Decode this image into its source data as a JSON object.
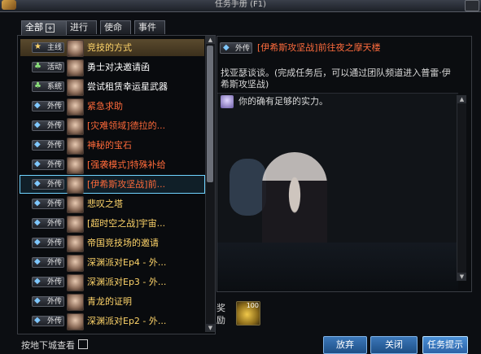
{
  "window": {
    "title": "任务手册 (F1)"
  },
  "tabs": [
    "全部",
    "进行",
    "使命",
    "事件"
  ],
  "quests": [
    {
      "badge": "主线",
      "name": "竞技的方式",
      "color": "#ffd56a",
      "icon": "star-icon"
    },
    {
      "badge": "活动",
      "name": "勇士对决邀请函",
      "color": "#ffffff",
      "icon": "leaf-icon"
    },
    {
      "badge": "系统",
      "name": "尝试租赁幸运星武器",
      "color": "#ffffff",
      "icon": "leaf-icon"
    },
    {
      "badge": "外传",
      "name": "紧急求助",
      "color": "#ff6a3a",
      "icon": "diamond-icon"
    },
    {
      "badge": "外传",
      "name": "[灾难领域]德拉的...",
      "color": "#ff6a3a",
      "icon": "diamond-icon"
    },
    {
      "badge": "外传",
      "name": "神秘的宝石",
      "color": "#ff6a3a",
      "icon": "diamond-icon"
    },
    {
      "badge": "外传",
      "name": "[强袭模式]特殊补给",
      "color": "#ff6a3a",
      "icon": "diamond-icon"
    },
    {
      "badge": "外传",
      "name": "[伊希斯攻坚战]前...",
      "color": "#ff6a3a",
      "icon": "diamond-icon",
      "selected": true
    },
    {
      "badge": "外传",
      "name": "悲叹之塔",
      "color": "#ffd56a",
      "icon": "diamond-icon"
    },
    {
      "badge": "外传",
      "name": "[超时空之战]宇宙...",
      "color": "#ffd56a",
      "icon": "diamond-icon"
    },
    {
      "badge": "外传",
      "name": "帝国竞技场的邀请",
      "color": "#ffd56a",
      "icon": "diamond-icon"
    },
    {
      "badge": "外传",
      "name": "深渊派对Ep4 - 外...",
      "color": "#ffd56a",
      "icon": "diamond-icon"
    },
    {
      "badge": "外传",
      "name": "深渊派对Ep3 - 外...",
      "color": "#ffd56a",
      "icon": "diamond-icon"
    },
    {
      "badge": "外传",
      "name": "青龙的证明",
      "color": "#ffd56a",
      "icon": "diamond-icon"
    },
    {
      "badge": "外传",
      "name": "深渊派对Ep2 - 外...",
      "color": "#ffd56a",
      "icon": "diamond-icon"
    }
  ],
  "detail": {
    "badge": "外传",
    "title": "[伊希斯攻坚战]前往夜之摩天楼",
    "description": "找亚瑟谈谈。(完成任务后，可以通过团队频道进入普雷·伊希斯攻坚战)",
    "npc_line": "你的确有足够的实力。"
  },
  "reward": {
    "label": "奖励",
    "quantity": "100"
  },
  "footer": {
    "checkbox_label": "按地下城查看",
    "buttons": [
      "放弃",
      "关闭",
      "任务提示"
    ]
  }
}
